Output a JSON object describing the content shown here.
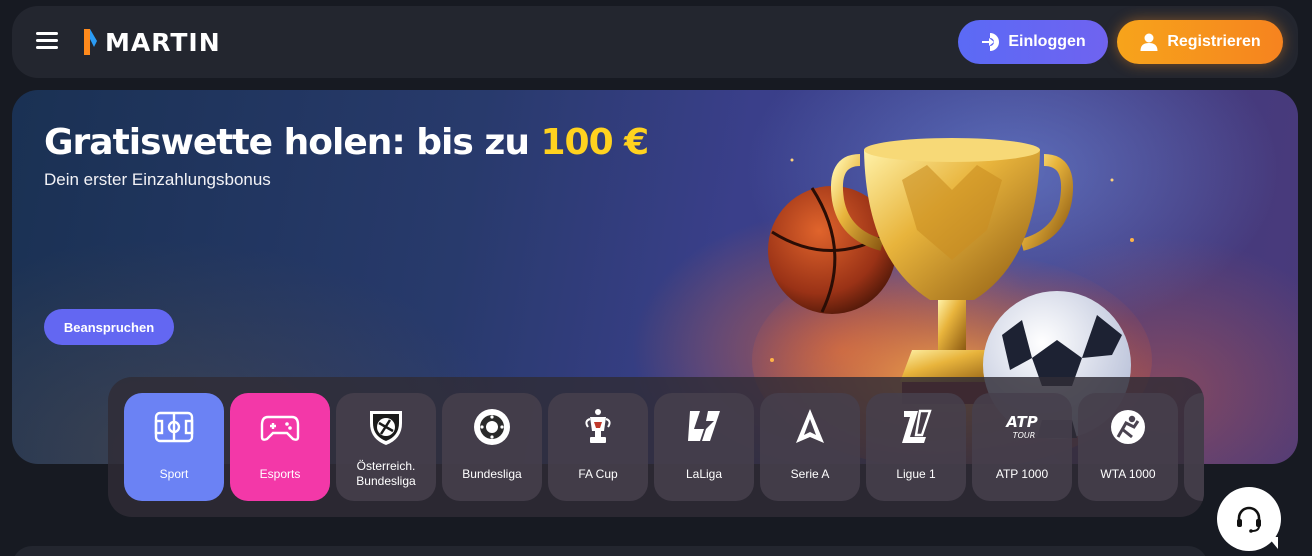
{
  "brand": {
    "logo_text": "MARTIN"
  },
  "header": {
    "login_label": "Einloggen",
    "register_label": "Registrieren"
  },
  "hero": {
    "title_prefix": "Gratiswette holen: bis zu ",
    "title_amount": "100 €",
    "subtitle": "Dein erster Einzahlungsbonus",
    "cta_label": "Beanspruchen"
  },
  "categories": [
    {
      "label": "Sport",
      "icon": "football-field-icon"
    },
    {
      "label": "Esports",
      "icon": "gamepad-icon"
    },
    {
      "label_line1": "Österreich.",
      "label_line2": "Bundesliga",
      "icon": "austrian-bundesliga-logo-icon"
    },
    {
      "label": "Bundesliga",
      "icon": "bundesliga-logo-icon"
    },
    {
      "label": "FA Cup",
      "icon": "fa-cup-trophy-icon"
    },
    {
      "label": "LaLiga",
      "icon": "laliga-logo-icon"
    },
    {
      "label": "Serie A",
      "icon": "serie-a-logo-icon"
    },
    {
      "label": "Ligue 1",
      "icon": "ligue-1-logo-icon"
    },
    {
      "label": "ATP 1000",
      "icon": "atp-tour-logo-icon",
      "logo_text": "ATP",
      "logo_subtext": "TOUR"
    },
    {
      "label": "WTA 1000",
      "icon": "wta-logo-icon"
    }
  ],
  "colors": {
    "login": "#5b6af5",
    "register": "#f6931d",
    "accent_amount": "#ffd21f",
    "sport_tile": "#6b82f4",
    "esports_tile": "#f338a8"
  },
  "support": {
    "icon": "headset-icon"
  }
}
